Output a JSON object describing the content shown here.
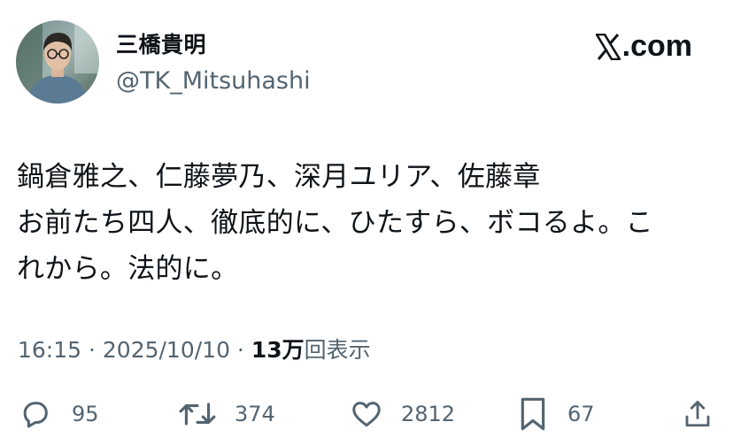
{
  "header": {
    "display_name": "三橋貴明",
    "handle": "@TK_Mitsuhashi",
    "avatar_icon": "avatar-photo",
    "brand_text": ".com",
    "brand_icon": "x-logo-icon"
  },
  "tweet": {
    "lines": [
      "鍋倉雅之、仁藤夢乃、深月ユリア、佐藤章",
      "お前たち四人、徹底的に、ひたすら、ボコるよ。こ",
      "れから。法的に。"
    ]
  },
  "meta": {
    "time": "16:15",
    "separator": " · ",
    "date": "2025/10/10",
    "views_count": "13万",
    "views_label": "回表示"
  },
  "actions": {
    "reply": {
      "icon": "reply-icon",
      "count": "95"
    },
    "retweet": {
      "icon": "retweet-icon",
      "count": "374"
    },
    "like": {
      "icon": "heart-icon",
      "count": "2812"
    },
    "bookmark": {
      "icon": "bookmark-icon",
      "count": "67"
    },
    "share": {
      "icon": "share-icon"
    }
  },
  "colors": {
    "text": "#0f1419",
    "secondary": "#536471",
    "background": "#ffffff"
  }
}
